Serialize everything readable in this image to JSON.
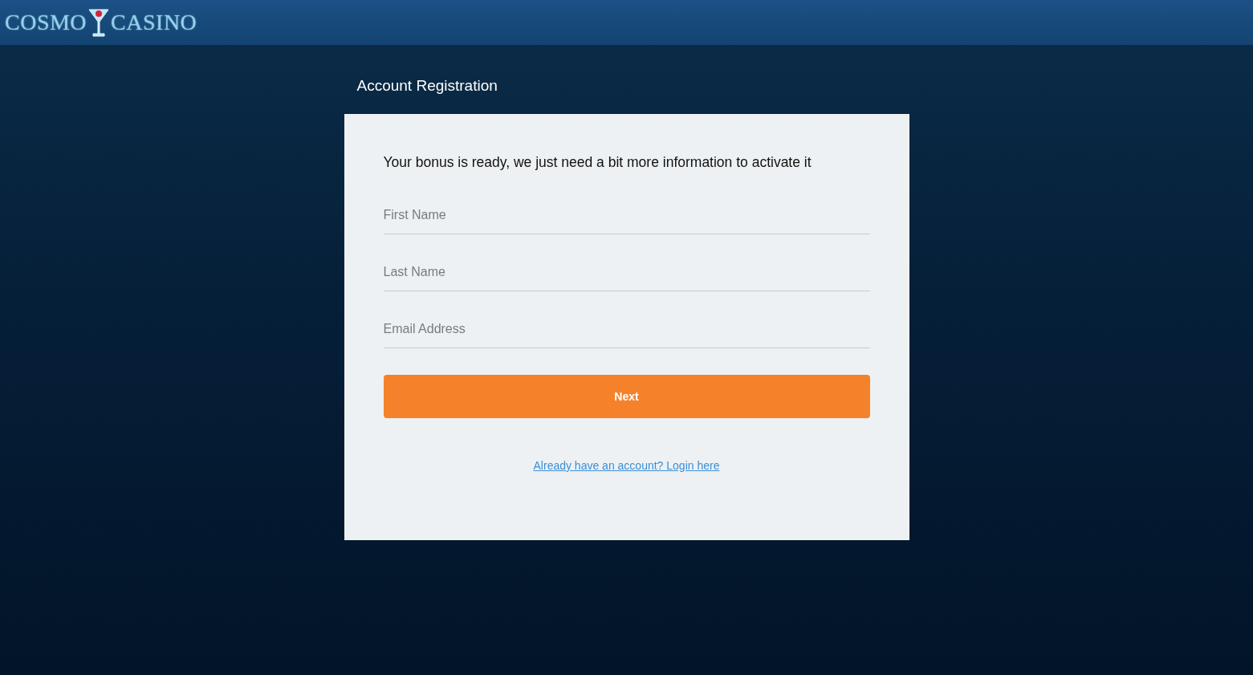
{
  "header": {
    "logo": {
      "left": "COSMO",
      "right": "CASINO"
    }
  },
  "page_title": "Account Registration",
  "form": {
    "intro": "Your bonus is ready, we just need a bit more information to activate it",
    "fields": [
      {
        "placeholder": "First Name"
      },
      {
        "placeholder": "Last Name"
      },
      {
        "placeholder": "Email Address"
      }
    ],
    "submit": "Next",
    "login_link": "Already have an account? Login here"
  }
}
